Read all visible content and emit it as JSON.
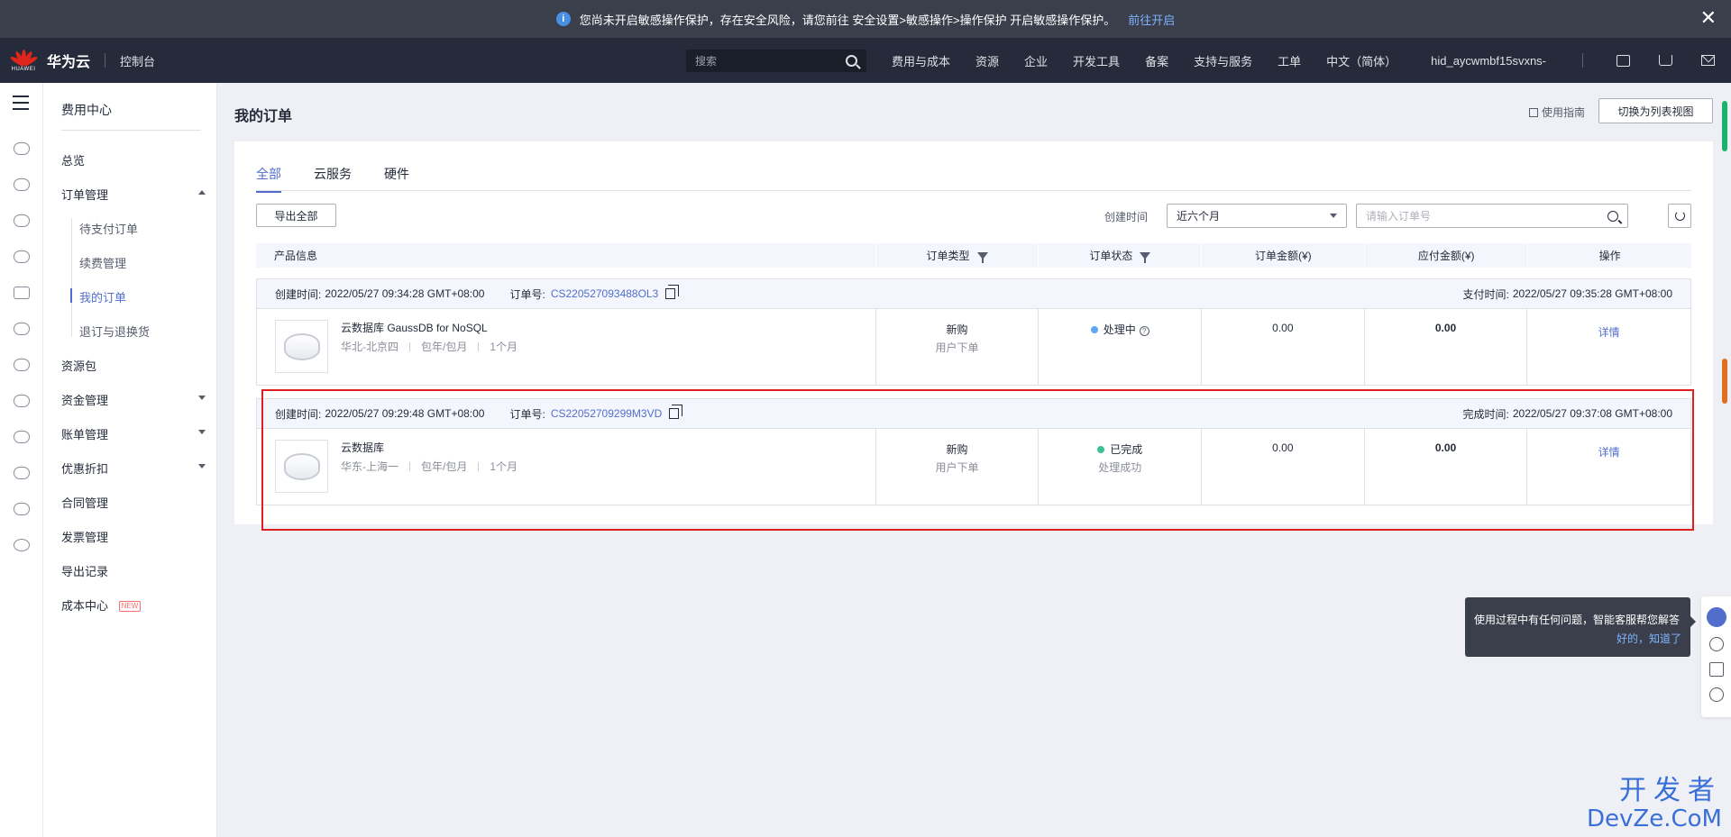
{
  "notice": {
    "text": "您尚未开启敏感操作保护，存在安全风险，请您前往 安全设置>敏感操作>操作保护 开启敏感操作保护。",
    "link": "前往开启",
    "close": "✕"
  },
  "header": {
    "brand_small": "HUAWEI",
    "brand": "华为云",
    "console": "控制台",
    "search_placeholder": "搜索",
    "nav": [
      "费用与成本",
      "资源",
      "企业",
      "开发工具",
      "备案",
      "支持与服务",
      "工单",
      "中文（简体）"
    ],
    "user": "hid_aycwmbf15svxns-"
  },
  "sidemenu": {
    "title": "费用中心",
    "items": {
      "overview": "总览",
      "order_mgmt": "订单管理",
      "pending": "待支付订单",
      "renew": "续费管理",
      "my_orders": "我的订单",
      "refund": "退订与退换货",
      "resource_pkg": "资源包",
      "fund_mgmt": "资金管理",
      "bill_mgmt": "账单管理",
      "discount": "优惠折扣",
      "contract": "合同管理",
      "invoice": "发票管理",
      "export_records": "导出记录",
      "cost_center": "成本中心",
      "new_badge": "NEW"
    }
  },
  "main": {
    "title": "我的订单",
    "guide": "使用指南",
    "switch_view": "切换为列表视图",
    "tabs": [
      "全部",
      "云服务",
      "硬件"
    ],
    "export_all": "导出全部",
    "create_time_label": "创建时间",
    "period_select": "近六个月",
    "order_search_placeholder": "请输入订单号"
  },
  "table": {
    "headers": [
      "产品信息",
      "订单类型",
      "订单状态",
      "订单金额(¥)",
      "应付金额(¥)",
      "操作"
    ]
  },
  "orders": [
    {
      "created_label": "创建时间:",
      "created": "2022/05/27 09:34:28 GMT+08:00",
      "order_no_label": "订单号:",
      "order_no": "CS220527093488OL3",
      "time_label": "支付时间:",
      "time": "2022/05/27 09:35:28 GMT+08:00",
      "product": "云数据库 GaussDB for NoSQL",
      "region": "华北-北京四",
      "billing": "包年/包月",
      "duration": "1个月",
      "type": "新购",
      "type_sub": "用户下单",
      "status": "处理中",
      "status_sub": "",
      "status_color": "#5ea7f7",
      "amount": "0.00",
      "payable": "0.00",
      "action": "详情"
    },
    {
      "created_label": "创建时间:",
      "created": "2022/05/27 09:29:48 GMT+08:00",
      "order_no_label": "订单号:",
      "order_no": "CS22052709299M3VD",
      "time_label": "完成时间:",
      "time": "2022/05/27 09:37:08 GMT+08:00",
      "product": "云数据库",
      "region": "华东-上海一",
      "billing": "包年/包月",
      "duration": "1个月",
      "type": "新购",
      "type_sub": "用户下单",
      "status": "已完成",
      "status_sub": "处理成功",
      "status_color": "#3ac295",
      "amount": "0.00",
      "payable": "0.00",
      "action": "详情"
    }
  ],
  "tip": {
    "text": "使用过程中有任何问题，智能客服帮您解答",
    "ack": "好的，知道了"
  },
  "watermark": {
    "line1": "开发者",
    "line2": "DevZe.CoM"
  },
  "colors": {
    "accent": "#526ecc",
    "header_bg": "#252b3a",
    "highlight": "#e02020"
  }
}
